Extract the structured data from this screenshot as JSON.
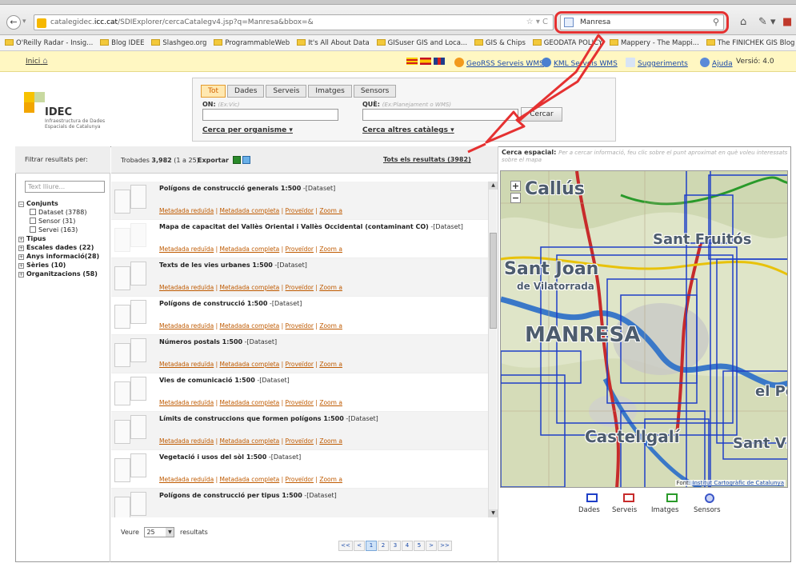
{
  "browser": {
    "url_prefix": "catalegidec.",
    "url_domain": "icc.cat",
    "url_rest": "/SDIExplorer/cercaCatalegv4.jsp?q=Manresa&bbox=&",
    "search_value": "Manresa",
    "bookmarks": [
      "O'Reilly Radar - Insig...",
      "Blog IDEE",
      "Slashgeo.org",
      "ProgrammableWeb",
      "It's All About Data",
      "GISuser GIS and Loca...",
      "GIS & Chips",
      "GEODATA POLICY",
      "Mappery - The Mappi...",
      "The FINICHEK GIS Blog"
    ]
  },
  "topbar": {
    "home_label": "Inici",
    "links": {
      "georss": "GeoRSS Serveis WMS",
      "kml": "KML Serveis WMS",
      "suggestions": "Suggeriments",
      "help": "Ajuda"
    },
    "version": "Versió: 4.0"
  },
  "logo": {
    "title": "IDEC",
    "subtitle": "Infraestructura de Dades Espacials de Catalunya"
  },
  "search": {
    "tabs": [
      "Tot",
      "Dades",
      "Serveis",
      "Imatges",
      "Sensors"
    ],
    "on_label": "ON:",
    "on_hint": "(Ex:Vic)",
    "que_label": "QUÈ:",
    "que_hint": "(Ex:Planejament o WMS)",
    "button": "Cercar",
    "by_org": "Cerca per organisme",
    "other_catalogs": "Cerca altres catàlegs"
  },
  "filters": {
    "title": "Filtrar resultats per:",
    "placeholder": "Text lliure...",
    "conjunts": "Conjunts",
    "items": [
      "Dataset (3788)",
      "Sensor (31)",
      "Servei (163)"
    ],
    "groups": [
      "Tipus",
      "Escales dades (22)",
      "Anys informació(28)",
      "Sèries (10)",
      "Organitzacions (58)"
    ]
  },
  "results": {
    "found_label": "Trobades",
    "found_count": "3,982",
    "found_range": "(1 a 25)",
    "export_label": "Exportar",
    "all_results": "Tots els resultats (3982)",
    "items": [
      {
        "title": "Polígons de construcció generals 1:500",
        "type": " -[Dataset]"
      },
      {
        "title": "Mapa de capacitat del Vallès Oriental i Vallès Occidental (contaminant CO)",
        "type": " -[Dataset]"
      },
      {
        "title": "Texts de les vies urbanes 1:500",
        "type": " -[Dataset]"
      },
      {
        "title": "Polígons de construcció 1:500",
        "type": " -[Dataset]"
      },
      {
        "title": "Números postals 1:500",
        "type": " -[Dataset]"
      },
      {
        "title": "Vies de comunicació 1:500",
        "type": " -[Dataset]"
      },
      {
        "title": "Límits de construccions que formen polígons 1:500",
        "type": " -[Dataset]"
      },
      {
        "title": "Vegetació i usos del sòl 1:500",
        "type": " -[Dataset]"
      },
      {
        "title": "Polígons de construcció per tipus 1:500",
        "type": " -[Dataset]"
      }
    ],
    "link_labels": {
      "short_meta": "Metadada reduïda",
      "full_meta": "Metadada completa",
      "provider": "Proveïdor",
      "zoom": "Zoom a"
    },
    "per_page_label": "Veure",
    "per_page_value": "25",
    "per_page_suffix": "resultats",
    "pager": [
      "<<",
      "<",
      "1",
      "2",
      "3",
      "4",
      "5",
      ">",
      ">>"
    ]
  },
  "map": {
    "title": "Cerca espacial:",
    "hint": "Per a cercar informació, feu clic sobre el punt aproximat en què voleu interessats sobre el mapa",
    "labels": {
      "callus": "Callús",
      "fruitos": "Sant Fruitós",
      "santjoan": "Sant Joan",
      "vilatorrada": "de Vilatorrada",
      "manresa": "MANRESA",
      "castellgali": "Castellgalí",
      "santvic": "Sant Vic",
      "elpo": "el Po"
    },
    "credit_prefix": "Font:",
    "credit_link": "Institut Cartogràfic de Catalunya",
    "legend": [
      {
        "label": "Dades",
        "color": "#1f3fc7"
      },
      {
        "label": "Serveis",
        "color": "#c72b2b"
      },
      {
        "label": "Imatges",
        "color": "#2a9a2a"
      },
      {
        "label": "Sensors",
        "color": "#3a55c7"
      }
    ]
  },
  "colors": {
    "accent": "#e53131",
    "link": "#1a4aa8",
    "result_link": "#bf5a00",
    "page_strip": "#fff7c2"
  }
}
